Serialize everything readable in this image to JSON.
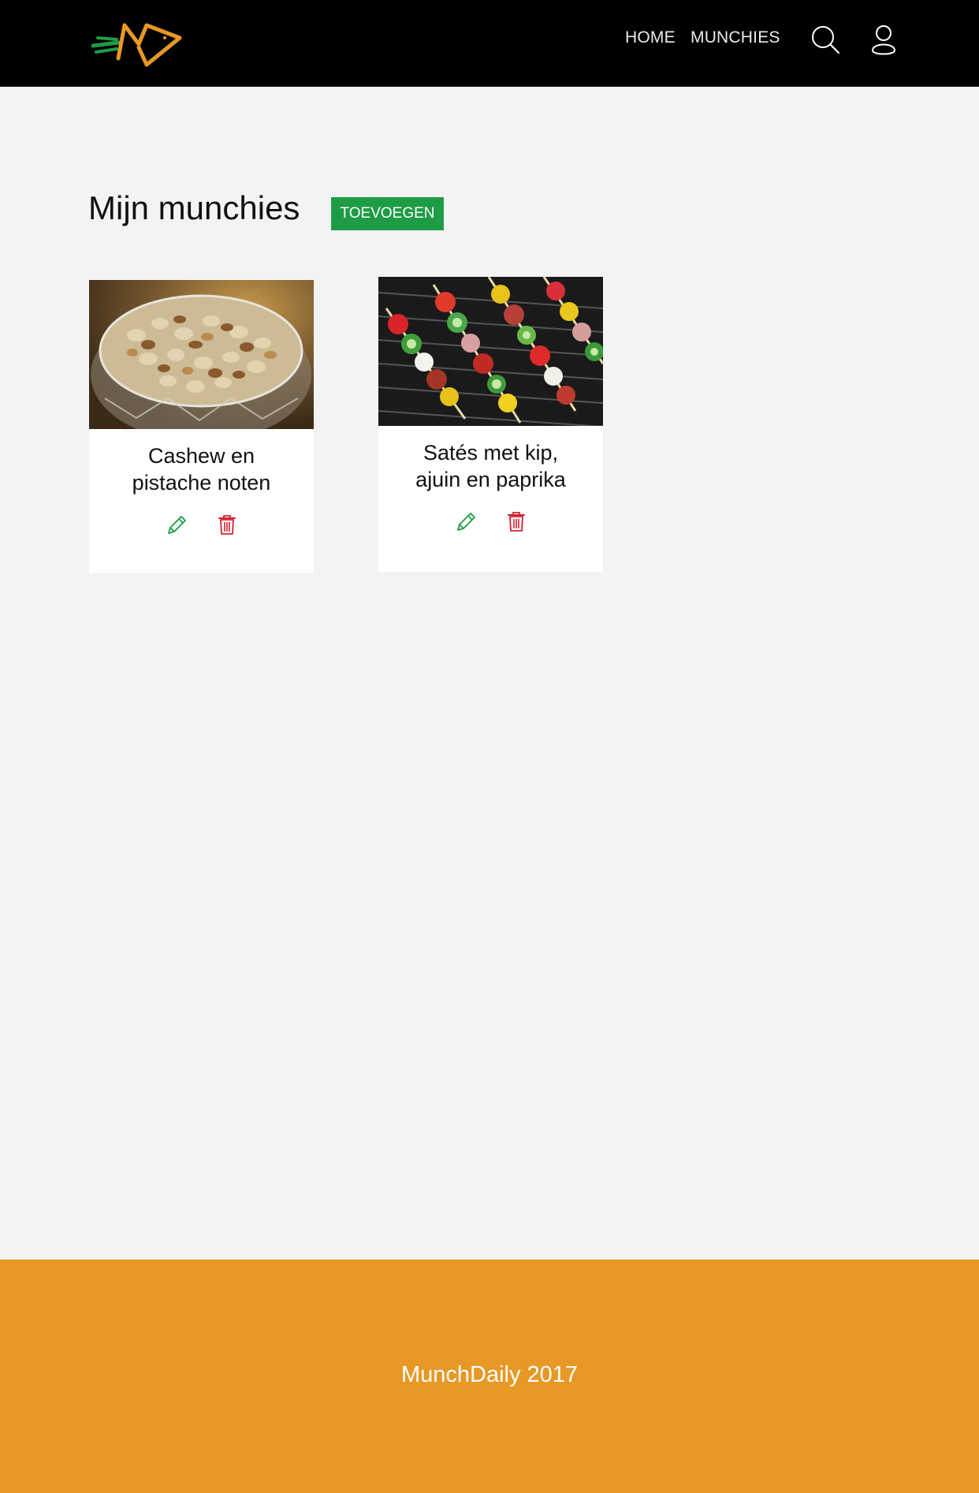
{
  "nav": {
    "home_label": "HOME",
    "munchies_label": "MUNCHIES"
  },
  "icons": {
    "search": "search-icon",
    "user": "user-icon",
    "edit": "pencil-icon",
    "delete": "trash-icon"
  },
  "main": {
    "title": "Mijn munchies",
    "add_button_label": "TOEVOEGEN"
  },
  "cards": [
    {
      "title_line1": "Cashew en",
      "title_line2": "pistache noten",
      "image": "bowl of mixed nuts"
    },
    {
      "title_line1": "Satés met kip,",
      "title_line2": "ajuin en paprika",
      "image": "skewers on a grill"
    }
  ],
  "footer": {
    "text": "MunchDaily 2017"
  },
  "colors": {
    "header_bg": "#000000",
    "page_bg": "#f3f3f3",
    "accent_green": "#1e9c45",
    "delete_red": "#d3202f",
    "footer_orange": "#e79825"
  }
}
